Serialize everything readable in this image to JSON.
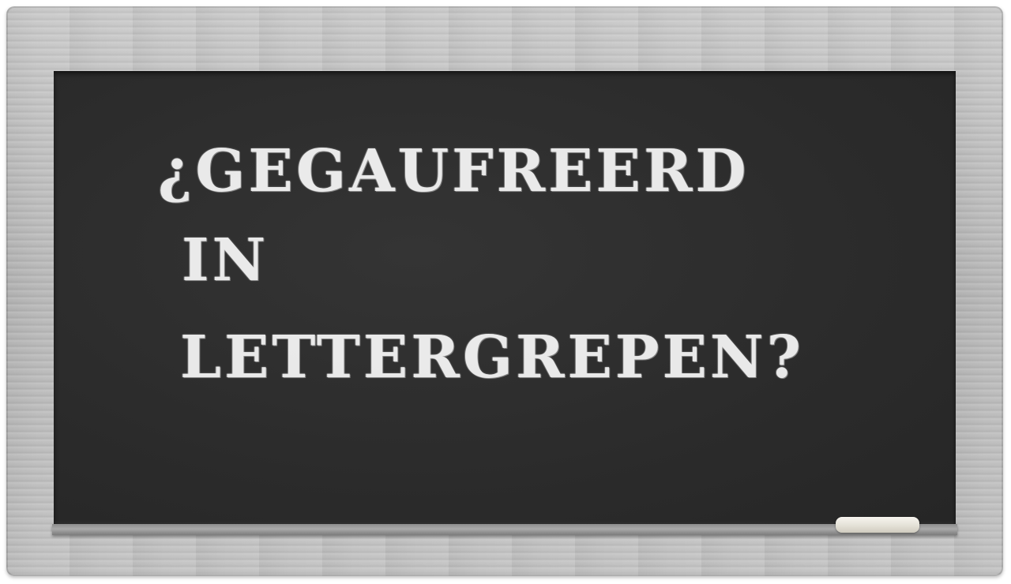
{
  "board": {
    "lines": [
      "¿GEGAUFREERD",
      "IN",
      "LETTERGREPEN?"
    ]
  },
  "colors": {
    "frame": "#c0c0c0",
    "board": "#2d2d2d",
    "chalk_text": "#f4f4f4",
    "chalk_stick": "#ece9e0"
  },
  "icons": {
    "chalk": "chalk-stick-icon"
  }
}
